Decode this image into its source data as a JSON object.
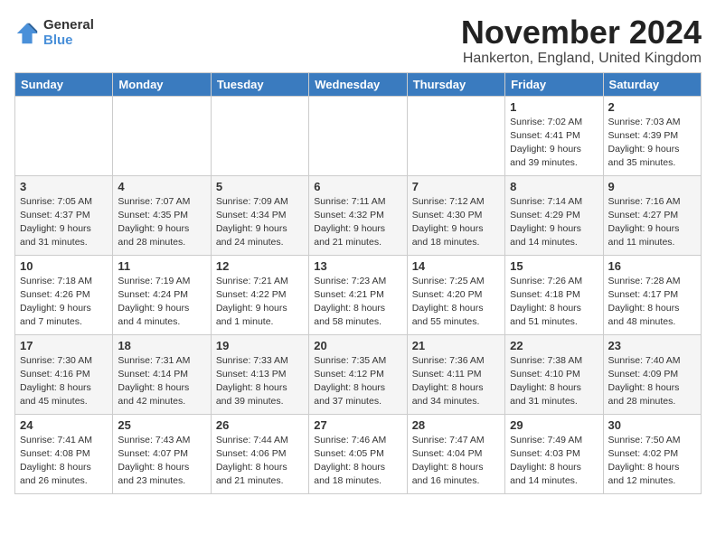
{
  "logo": {
    "general": "General",
    "blue": "Blue"
  },
  "title": "November 2024",
  "location": "Hankerton, England, United Kingdom",
  "days_of_week": [
    "Sunday",
    "Monday",
    "Tuesday",
    "Wednesday",
    "Thursday",
    "Friday",
    "Saturday"
  ],
  "weeks": [
    [
      {
        "day": "",
        "info": ""
      },
      {
        "day": "",
        "info": ""
      },
      {
        "day": "",
        "info": ""
      },
      {
        "day": "",
        "info": ""
      },
      {
        "day": "",
        "info": ""
      },
      {
        "day": "1",
        "info": "Sunrise: 7:02 AM\nSunset: 4:41 PM\nDaylight: 9 hours\nand 39 minutes."
      },
      {
        "day": "2",
        "info": "Sunrise: 7:03 AM\nSunset: 4:39 PM\nDaylight: 9 hours\nand 35 minutes."
      }
    ],
    [
      {
        "day": "3",
        "info": "Sunrise: 7:05 AM\nSunset: 4:37 PM\nDaylight: 9 hours\nand 31 minutes."
      },
      {
        "day": "4",
        "info": "Sunrise: 7:07 AM\nSunset: 4:35 PM\nDaylight: 9 hours\nand 28 minutes."
      },
      {
        "day": "5",
        "info": "Sunrise: 7:09 AM\nSunset: 4:34 PM\nDaylight: 9 hours\nand 24 minutes."
      },
      {
        "day": "6",
        "info": "Sunrise: 7:11 AM\nSunset: 4:32 PM\nDaylight: 9 hours\nand 21 minutes."
      },
      {
        "day": "7",
        "info": "Sunrise: 7:12 AM\nSunset: 4:30 PM\nDaylight: 9 hours\nand 18 minutes."
      },
      {
        "day": "8",
        "info": "Sunrise: 7:14 AM\nSunset: 4:29 PM\nDaylight: 9 hours\nand 14 minutes."
      },
      {
        "day": "9",
        "info": "Sunrise: 7:16 AM\nSunset: 4:27 PM\nDaylight: 9 hours\nand 11 minutes."
      }
    ],
    [
      {
        "day": "10",
        "info": "Sunrise: 7:18 AM\nSunset: 4:26 PM\nDaylight: 9 hours\nand 7 minutes."
      },
      {
        "day": "11",
        "info": "Sunrise: 7:19 AM\nSunset: 4:24 PM\nDaylight: 9 hours\nand 4 minutes."
      },
      {
        "day": "12",
        "info": "Sunrise: 7:21 AM\nSunset: 4:22 PM\nDaylight: 9 hours\nand 1 minute."
      },
      {
        "day": "13",
        "info": "Sunrise: 7:23 AM\nSunset: 4:21 PM\nDaylight: 8 hours\nand 58 minutes."
      },
      {
        "day": "14",
        "info": "Sunrise: 7:25 AM\nSunset: 4:20 PM\nDaylight: 8 hours\nand 55 minutes."
      },
      {
        "day": "15",
        "info": "Sunrise: 7:26 AM\nSunset: 4:18 PM\nDaylight: 8 hours\nand 51 minutes."
      },
      {
        "day": "16",
        "info": "Sunrise: 7:28 AM\nSunset: 4:17 PM\nDaylight: 8 hours\nand 48 minutes."
      }
    ],
    [
      {
        "day": "17",
        "info": "Sunrise: 7:30 AM\nSunset: 4:16 PM\nDaylight: 8 hours\nand 45 minutes."
      },
      {
        "day": "18",
        "info": "Sunrise: 7:31 AM\nSunset: 4:14 PM\nDaylight: 8 hours\nand 42 minutes."
      },
      {
        "day": "19",
        "info": "Sunrise: 7:33 AM\nSunset: 4:13 PM\nDaylight: 8 hours\nand 39 minutes."
      },
      {
        "day": "20",
        "info": "Sunrise: 7:35 AM\nSunset: 4:12 PM\nDaylight: 8 hours\nand 37 minutes."
      },
      {
        "day": "21",
        "info": "Sunrise: 7:36 AM\nSunset: 4:11 PM\nDaylight: 8 hours\nand 34 minutes."
      },
      {
        "day": "22",
        "info": "Sunrise: 7:38 AM\nSunset: 4:10 PM\nDaylight: 8 hours\nand 31 minutes."
      },
      {
        "day": "23",
        "info": "Sunrise: 7:40 AM\nSunset: 4:09 PM\nDaylight: 8 hours\nand 28 minutes."
      }
    ],
    [
      {
        "day": "24",
        "info": "Sunrise: 7:41 AM\nSunset: 4:08 PM\nDaylight: 8 hours\nand 26 minutes."
      },
      {
        "day": "25",
        "info": "Sunrise: 7:43 AM\nSunset: 4:07 PM\nDaylight: 8 hours\nand 23 minutes."
      },
      {
        "day": "26",
        "info": "Sunrise: 7:44 AM\nSunset: 4:06 PM\nDaylight: 8 hours\nand 21 minutes."
      },
      {
        "day": "27",
        "info": "Sunrise: 7:46 AM\nSunset: 4:05 PM\nDaylight: 8 hours\nand 18 minutes."
      },
      {
        "day": "28",
        "info": "Sunrise: 7:47 AM\nSunset: 4:04 PM\nDaylight: 8 hours\nand 16 minutes."
      },
      {
        "day": "29",
        "info": "Sunrise: 7:49 AM\nSunset: 4:03 PM\nDaylight: 8 hours\nand 14 minutes."
      },
      {
        "day": "30",
        "info": "Sunrise: 7:50 AM\nSunset: 4:02 PM\nDaylight: 8 hours\nand 12 minutes."
      }
    ]
  ]
}
